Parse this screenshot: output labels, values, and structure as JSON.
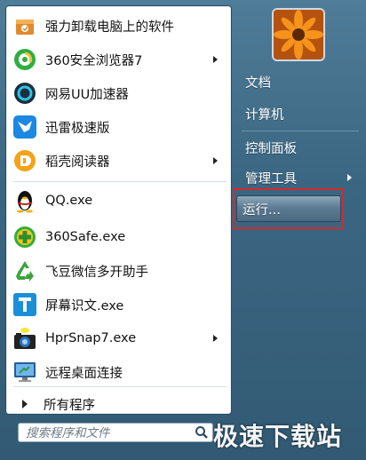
{
  "start_menu": {
    "programs": [
      {
        "label": "强力卸载电脑上的软件",
        "icon": "uninstall-box-icon",
        "has_submenu": false
      },
      {
        "label": "360安全浏览器7",
        "icon": "360-browser-icon",
        "has_submenu": true
      },
      {
        "label": "网易UU加速器",
        "icon": "uu-accelerator-icon",
        "has_submenu": false
      },
      {
        "label": "迅雷极速版",
        "icon": "thunder-bird-icon",
        "has_submenu": false
      },
      {
        "label": "稻壳阅读器",
        "icon": "docer-reader-icon",
        "has_submenu": true
      },
      {
        "label": "QQ.exe",
        "icon": "qq-penguin-icon",
        "has_submenu": false
      },
      {
        "label": "360Safe.exe",
        "icon": "360-safe-icon",
        "has_submenu": false
      },
      {
        "label": "飞豆微信多开助手",
        "icon": "recycle-icon",
        "has_submenu": false
      },
      {
        "label": "屏幕识文.exe",
        "icon": "t-text-icon",
        "has_submenu": false
      },
      {
        "label": "HprSnap7.exe",
        "icon": "camera-icon",
        "has_submenu": true
      },
      {
        "label": "远程桌面连接",
        "icon": "remote-desktop-icon",
        "has_submenu": false
      }
    ],
    "all_programs_label": "所有程序",
    "search_placeholder": "搜索程序和文件"
  },
  "right_panel": {
    "items": [
      {
        "label": "文档",
        "has_submenu": false
      },
      {
        "label": "计算机",
        "has_submenu": false
      },
      {
        "label": "控制面板",
        "has_submenu": false
      },
      {
        "label": "管理工具",
        "has_submenu": true
      },
      {
        "label": "运行...",
        "has_submenu": false
      }
    ]
  },
  "watermark": "极速下载站",
  "colors": {
    "highlight_border": "#d42a2a",
    "menu_bg": "#3b6682"
  }
}
